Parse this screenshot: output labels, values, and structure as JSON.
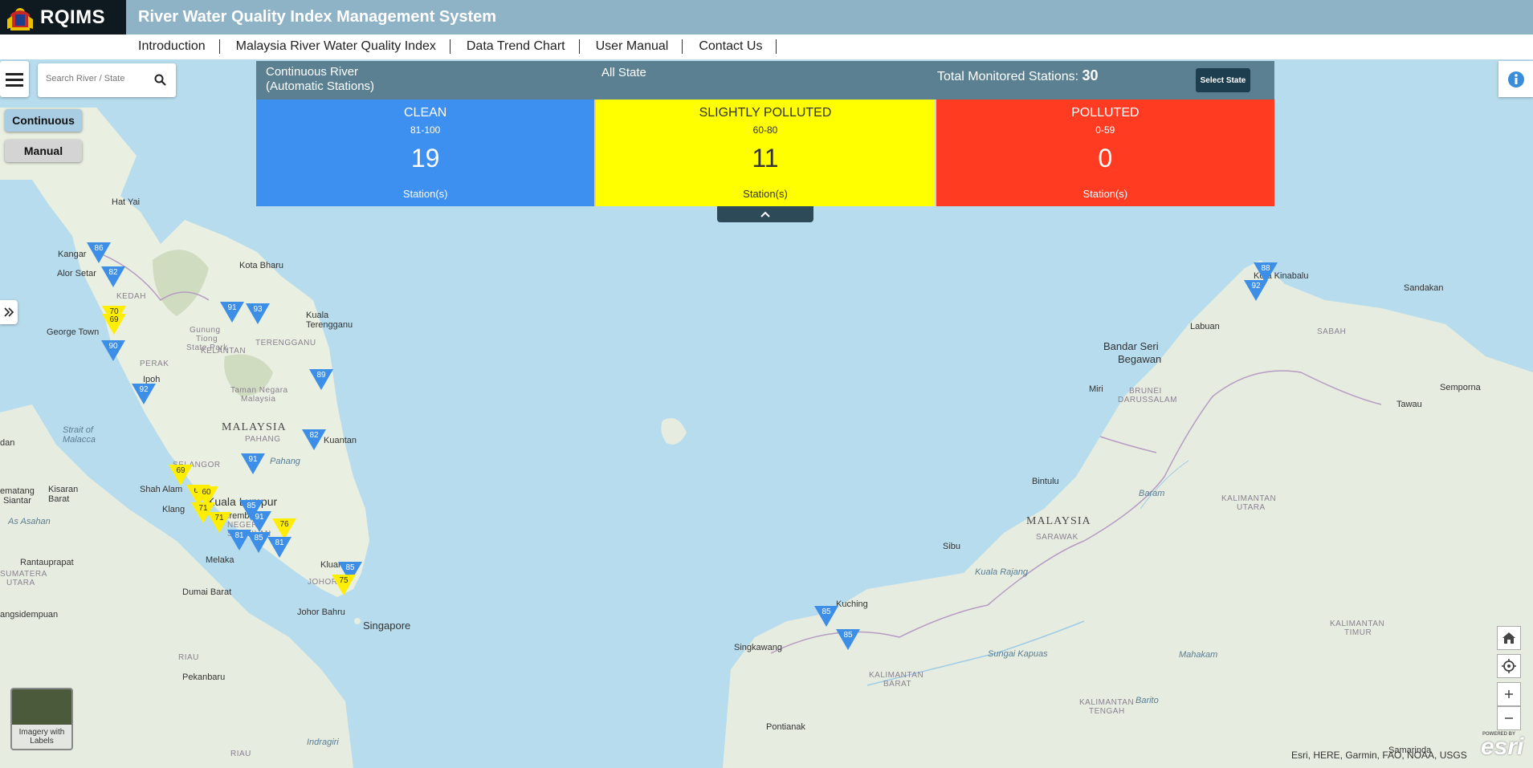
{
  "header": {
    "logo_text": "RQIMS",
    "title": "River Water Quality Index Management System",
    "bg_color": "#8fb3c6"
  },
  "nav": {
    "items": [
      "Introduction",
      "Malaysia River Water Quality Index",
      "Data Trend Chart",
      "User Manual",
      "Contact Us"
    ]
  },
  "search": {
    "placeholder": "Search River / State"
  },
  "modes": {
    "continuous": "Continuous",
    "manual": "Manual"
  },
  "panel": {
    "type_line1": "Continuous River",
    "type_line2": "(Automatic Stations)",
    "state": "All State",
    "total_label": "Total Monitored Stations:",
    "total_value": "30",
    "select_state": "Select State"
  },
  "cards": [
    {
      "name": "CLEAN",
      "range": "81-100",
      "count": "19",
      "unit": "Station(s)",
      "color": "#3d8ff0"
    },
    {
      "name": "SLIGHTLY POLLUTED",
      "range": "60-80",
      "count": "11",
      "unit": "Station(s)",
      "color": "#ffff00"
    },
    {
      "name": "POLLUTED",
      "range": "0-59",
      "count": "0",
      "unit": "Station(s)",
      "color": "#ff3b22"
    }
  ],
  "map": {
    "labels": {
      "hat_yai": "Hat Yai",
      "kangar": "Kangar",
      "alor_setar": "Alor Setar",
      "kedah": "KEDAH",
      "kota_bharu": "Kota Bharu",
      "gunung_tahan": "Gunung",
      "tiong": "Tiong",
      "state_park": "State Park",
      "kelantan": "KELANTAN",
      "kuala_terengganu_1": "Kuala",
      "kuala_terengganu_2": "Terengganu",
      "terengganu": "TERENGGANU",
      "george_town": "George Town",
      "perak": "PERAK",
      "ipoh": "Ipoh",
      "taman_negara_1": "Taman Negara",
      "taman_negara_2": "Malaysia",
      "strait_1": "Strait of",
      "strait_2": "Malacca",
      "malaysia_w": "MALAYSIA",
      "pahang_cap": "PAHANG",
      "pahang": "Pahang",
      "kuantan": "Kuantan",
      "selangor": "SELANGOR",
      "shah_alam": "Shah Alam",
      "klang": "Klang",
      "kuala_lumpur": "Kuala Lumpur",
      "seremban": "Seremban",
      "negeri": "NEGERI",
      "sembilan": "SEMBILAN",
      "melaka": "Melaka",
      "kluang": "Kluang",
      "johor": "JOHOR",
      "johor_bahru": "Johor Bahru",
      "singapore": "Singapore",
      "dumai": "Dumai Barat",
      "pekanbaru": "Pekanbaru",
      "riau": "RIAU",
      "riau2": "RIAU",
      "kisaran_1": "Kisaran",
      "kisaran_2": "Barat",
      "pematang_1": "ematang",
      "pematang_2": "Siantar",
      "dan": "dan",
      "rantauprapat": "Rantauprapat",
      "sumatera": "SUMATERA",
      "utara": "UTARA",
      "angsidempuan": "angsidempuan",
      "singkawang": "Singkawang",
      "kuching": "Kuching",
      "kalbar_1": "KALIMANTAN",
      "kalbar_2": "BARAT",
      "pontianak": "Pontianak",
      "sibu": "Sibu",
      "kuala_rajang": "Kuala Rajang",
      "malaysia_e": "MALAYSIA",
      "sarawak": "SARAWAK",
      "bintulu": "Bintulu",
      "miri": "Miri",
      "brunei_1": "BRUNEI",
      "brunei_2": "DARUSSALAM",
      "bsb_1": "Bandar Seri",
      "bsb_2": "Begawan",
      "labuan": "Labuan",
      "kota_kinabalu": "Kota Kinabalu",
      "sabah": "SABAH",
      "sandakan": "Sandakan",
      "tawau": "Tawau",
      "semporna": "Semporna",
      "kalut_1": "KALIMANTAN",
      "kalut_2": "UTARA",
      "kaltim_1": "KALIMANTAN",
      "kaltim_2": "TIMUR",
      "kalteng_1": "KALIMANTAN",
      "kalteng_2": "TENGAH",
      "samarinda": "Samarinda",
      "sungai_kapuas": "Sungai Kapuas",
      "mahakam": "Mahakam",
      "barito": "Barito",
      "baram": "Baram",
      "indragiri": "Indragiri",
      "asahan": "As Asahan"
    },
    "markers": [
      {
        "v": "86",
        "c": "b"
      },
      {
        "v": "82",
        "c": "b"
      },
      {
        "v": "70",
        "c": "y"
      },
      {
        "v": "69",
        "c": "y"
      },
      {
        "v": "90",
        "c": "b"
      },
      {
        "v": "91",
        "c": "b"
      },
      {
        "v": "93",
        "c": "b"
      },
      {
        "v": "92",
        "c": "b"
      },
      {
        "v": "89",
        "c": "b"
      },
      {
        "v": "82",
        "c": "b"
      },
      {
        "v": "91",
        "c": "b"
      },
      {
        "v": "69",
        "c": "y"
      },
      {
        "v": "60",
        "c": "y"
      },
      {
        "v": "60",
        "c": "y"
      },
      {
        "v": "71",
        "c": "y"
      },
      {
        "v": "85",
        "c": "b"
      },
      {
        "v": "71",
        "c": "y"
      },
      {
        "v": "91",
        "c": "b"
      },
      {
        "v": "76",
        "c": "y"
      },
      {
        "v": "81",
        "c": "b"
      },
      {
        "v": "85",
        "c": "b"
      },
      {
        "v": "81",
        "c": "b"
      },
      {
        "v": "85",
        "c": "b"
      },
      {
        "v": "75",
        "c": "y"
      },
      {
        "v": "85",
        "c": "b"
      },
      {
        "v": "85",
        "c": "b"
      },
      {
        "v": "88",
        "c": "b"
      },
      {
        "v": "92",
        "c": "b"
      }
    ],
    "basemap_label": "Imagery with Labels",
    "attribution": "Esri, HERE, Garmin, FAO, NOAA, USGS",
    "esri_logo": "esri",
    "powered_by": "POWERED BY"
  },
  "icons": [
    "crest-icon",
    "menu-icon",
    "search-icon",
    "double-chevron-right-icon",
    "chevron-up-icon",
    "info-icon",
    "home-icon",
    "locate-icon",
    "plus-icon",
    "minus-icon"
  ]
}
